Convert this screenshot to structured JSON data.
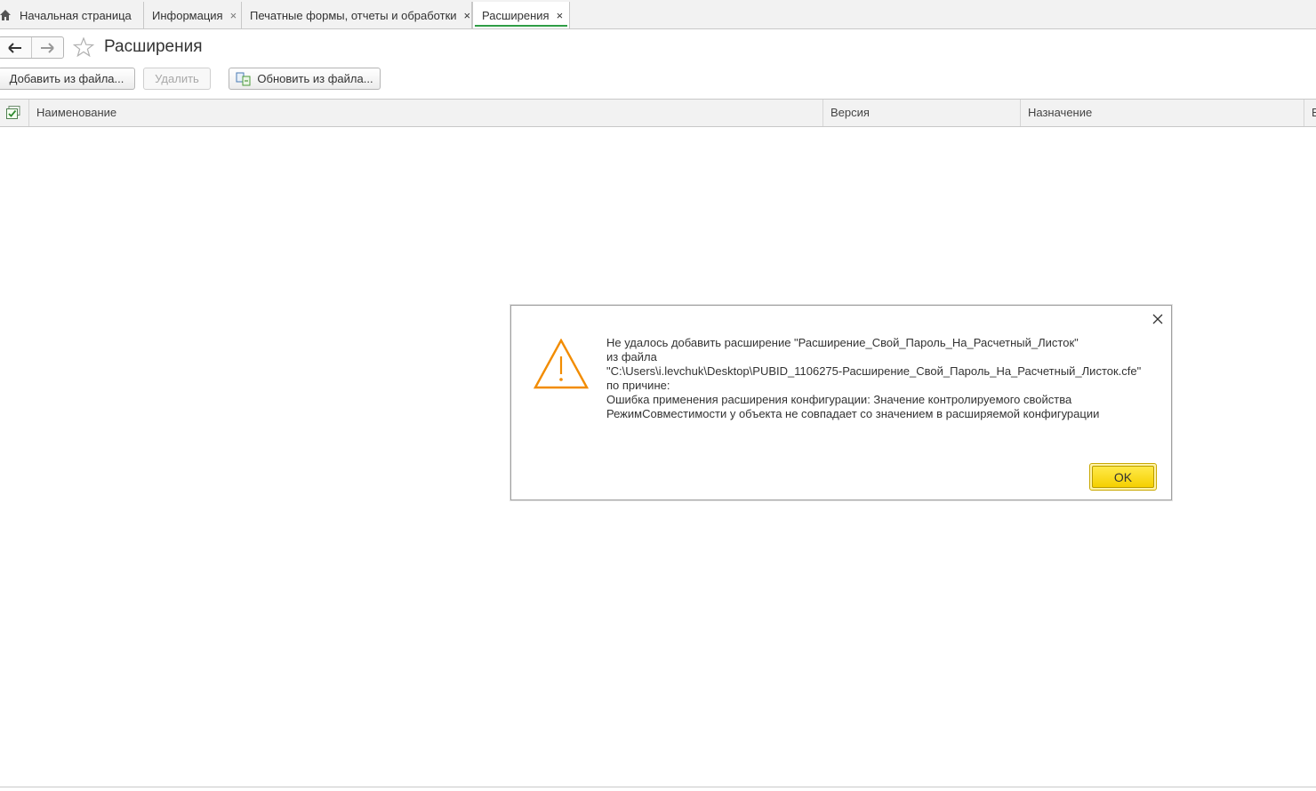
{
  "tabs": [
    {
      "label": "Начальная страница",
      "closable": false,
      "active": false,
      "icon": "home-icon"
    },
    {
      "label": "Информация",
      "closable": true,
      "active": false
    },
    {
      "label": "Печатные формы, отчеты и обработки",
      "closable": true,
      "active": false
    },
    {
      "label": "Расширения",
      "closable": true,
      "active": true
    }
  ],
  "tab_close_glyph": "×",
  "page": {
    "title": "Расширения"
  },
  "toolbar": {
    "add_from_file": "Добавить из файла...",
    "delete": "Удалить",
    "update_from_file": "Обновить из файла..."
  },
  "table": {
    "columns": [
      "Наименование",
      "Версия",
      "Назначение",
      "В"
    ]
  },
  "dialog": {
    "message_lines": [
      "Не удалось добавить расширение \"Расширение_Свой_Пароль_На_Расчетный_Листок\"",
      "из файла",
      "\"C:\\Users\\i.levchuk\\Desktop\\PUBID_1106275-Расширение_Свой_Пароль_На_Расчетный_Листок.cfe\"",
      "по причине:",
      "Ошибка применения расширения конфигурации: Значение контролируемого свойства",
      "РежимСовместимости у объекта  не совпадает со значением в расширяемой конфигурации"
    ],
    "ok_label": "OK"
  },
  "colors": {
    "accent_green": "#2f9d45",
    "warning_orange": "#f28c00",
    "ok_yellow": "#f9dc1a"
  }
}
